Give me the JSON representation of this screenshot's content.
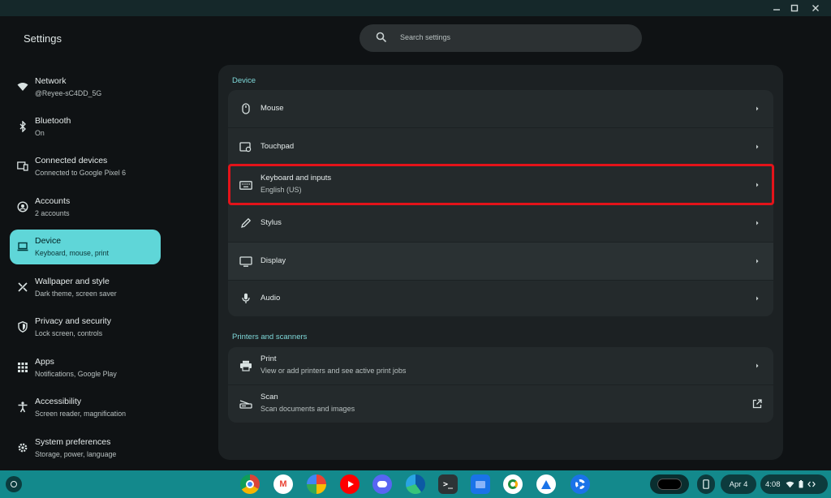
{
  "app": {
    "title": "Settings"
  },
  "search": {
    "placeholder": "Search settings"
  },
  "colors": {
    "accent": "#5fd6d8",
    "highlight": "#e3131a",
    "shelf": "#13898c"
  },
  "sidebar": {
    "items": [
      {
        "title": "Network",
        "subtitle": "@Reyee-sC4DD_5G",
        "icon": "wifi-icon"
      },
      {
        "title": "Bluetooth",
        "subtitle": "On",
        "icon": "bluetooth-icon"
      },
      {
        "title": "Connected devices",
        "subtitle": "Connected to Google Pixel 6",
        "icon": "connected-devices-icon"
      },
      {
        "title": "Accounts",
        "subtitle": "2 accounts",
        "icon": "accounts-icon"
      },
      {
        "title": "Device",
        "subtitle": "Keyboard, mouse, print",
        "icon": "laptop-icon",
        "active": true
      },
      {
        "title": "Wallpaper and style",
        "subtitle": "Dark theme, screen saver",
        "icon": "palette-icon"
      },
      {
        "title": "Privacy and security",
        "subtitle": "Lock screen, controls",
        "icon": "shield-icon"
      },
      {
        "title": "Apps",
        "subtitle": "Notifications, Google Play",
        "icon": "apps-grid-icon"
      },
      {
        "title": "Accessibility",
        "subtitle": "Screen reader, magnification",
        "icon": "accessibility-icon"
      },
      {
        "title": "System preferences",
        "subtitle": "Storage, power, language",
        "icon": "gear-icon"
      }
    ]
  },
  "main": {
    "device_section": {
      "heading": "Device",
      "rows": [
        {
          "title": "Mouse",
          "icon": "mouse-icon"
        },
        {
          "title": "Touchpad",
          "icon": "touchpad-icon"
        },
        {
          "title": "Keyboard and inputs",
          "subtitle": "English (US)",
          "icon": "keyboard-icon"
        },
        {
          "title": "Stylus",
          "icon": "stylus-icon"
        },
        {
          "title": "Display",
          "icon": "display-icon"
        },
        {
          "title": "Audio",
          "icon": "microphone-icon"
        }
      ]
    },
    "printers_section": {
      "heading": "Printers and scanners",
      "rows": [
        {
          "title": "Print",
          "subtitle": "View or add printers and see active print jobs",
          "icon": "printer-icon"
        },
        {
          "title": "Scan",
          "subtitle": "Scan documents and images",
          "icon": "scanner-icon"
        }
      ]
    }
  },
  "shelf": {
    "apps": [
      "chrome-icon",
      "gmail-icon",
      "photos-icon",
      "youtube-music-icon",
      "discord-icon",
      "edge-icon",
      "terminal-icon",
      "files-icon",
      "camera-icon",
      "lab-icon",
      "settings-icon"
    ],
    "date": "Apr 4",
    "time": "4:08"
  }
}
